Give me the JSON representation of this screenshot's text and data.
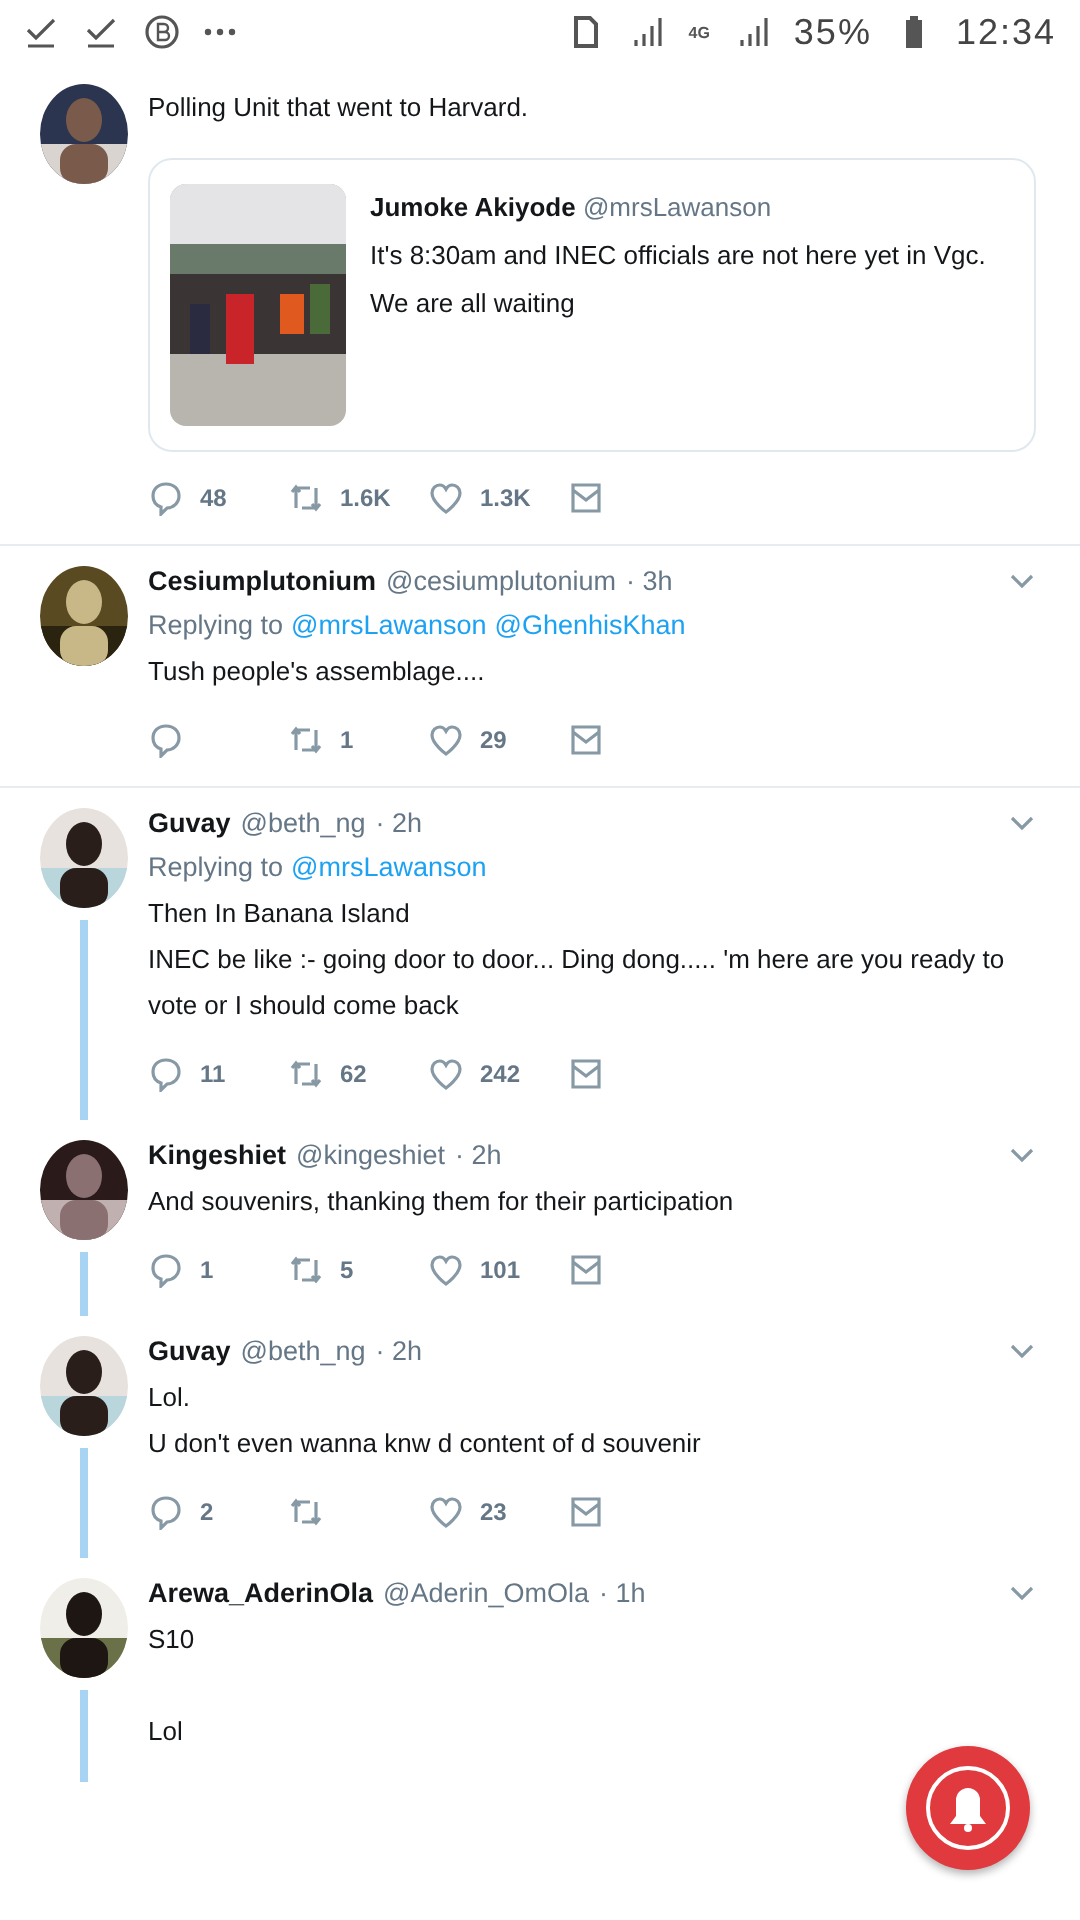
{
  "status_bar": {
    "network": "4G",
    "battery": "35%",
    "time": "12:34"
  },
  "tweets": [
    {
      "paragraphs": [
        [
          "Polling Unit that went to Harvard."
        ]
      ],
      "quote": {
        "name": "Jumoke Akiyode",
        "handle": "@mrsLawanson",
        "text": "It's 8:30am and INEC officials are not here yet in Vgc. We are all waiting"
      },
      "actions": {
        "replies": "48",
        "retweets": "1.6K",
        "likes": "1.3K"
      },
      "thread": false,
      "divider": true
    },
    {
      "name": "Cesiumplutonium",
      "handle": "@cesiumplutonium",
      "time": "· 3h",
      "replying_to": {
        "label": "Replying to",
        "mentions": [
          "@mrsLawanson",
          "@GhenhisKhan"
        ]
      },
      "paragraphs": [
        [
          "Tush people's assemblage...."
        ]
      ],
      "actions": {
        "retweets": "1",
        "likes": "29"
      },
      "thread": false,
      "divider": true
    },
    {
      "name": "Guvay",
      "handle": "@beth_ng",
      "time": "· 2h",
      "replying_to": {
        "label": "Replying to",
        "mentions": [
          "@mrsLawanson"
        ]
      },
      "paragraphs": [
        [
          "Then In Banana Island",
          "INEC be like :- going door to door... Ding dong..... 'm here are you ready to vote or I should come back"
        ]
      ],
      "actions": {
        "replies": "11",
        "retweets": "62",
        "likes": "242"
      },
      "thread": true,
      "divider": false
    },
    {
      "name": "Kingeshiet",
      "handle": "@kingeshiet",
      "time": "· 2h",
      "paragraphs": [
        [
          "And souvenirs, thanking them for their participation"
        ]
      ],
      "actions": {
        "replies": "1",
        "retweets": "5",
        "likes": "101"
      },
      "thread": true,
      "divider": false
    },
    {
      "name": "Guvay",
      "handle": "@beth_ng",
      "time": "· 2h",
      "paragraphs": [
        [
          "Lol.",
          "U don't even wanna knw d content of d souvenir"
        ]
      ],
      "actions": {
        "replies": "2",
        "likes": "23"
      },
      "thread": true,
      "divider": false
    },
    {
      "name": "Arewa_AderinOla",
      "handle": "@Aderin_OmOla",
      "time": "· 1h",
      "paragraphs": [
        [
          "S10"
        ],
        [
          "Lol"
        ]
      ],
      "thread": true,
      "divider": false
    }
  ]
}
